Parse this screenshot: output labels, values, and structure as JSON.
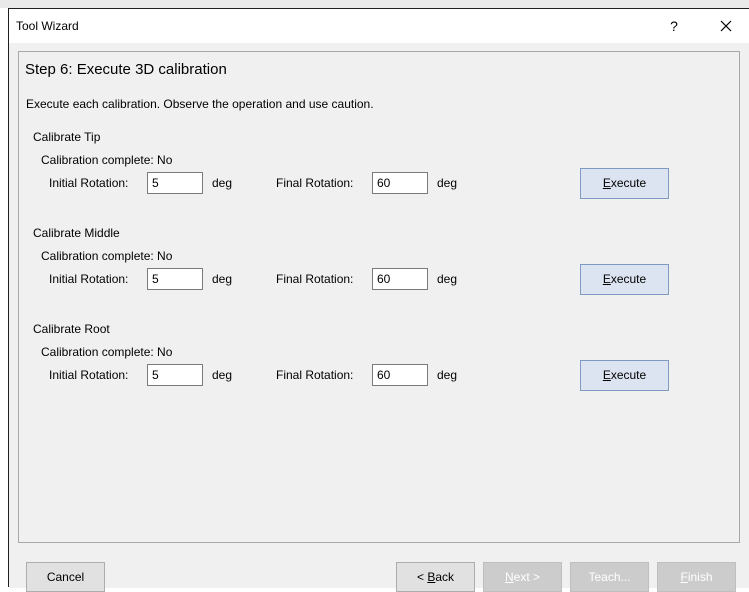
{
  "window": {
    "title": "Tool Wizard",
    "help_label": "?"
  },
  "step": {
    "title": "Step 6: Execute 3D calibration",
    "instructions": "Execute each calibration.  Observe the operation and use caution."
  },
  "calibrations": [
    {
      "title": "Calibrate Tip",
      "status": "Calibration complete: No",
      "initial_label": "Initial Rotation:",
      "initial_value": "5",
      "initial_unit": "deg",
      "final_label": "Final Rotation:",
      "final_value": "60",
      "final_unit": "deg",
      "execute_pre": "",
      "execute_key": "E",
      "execute_post": "xecute"
    },
    {
      "title": "Calibrate Middle",
      "status": "Calibration complete: No",
      "initial_label": "Initial Rotation:",
      "initial_value": "5",
      "initial_unit": "deg",
      "final_label": "Final Rotation:",
      "final_value": "60",
      "final_unit": "deg",
      "execute_pre": "",
      "execute_key": "E",
      "execute_post": "xecute"
    },
    {
      "title": "Calibrate Root",
      "status": "Calibration complete: No",
      "initial_label": "Initial Rotation:",
      "initial_value": "5",
      "initial_unit": "deg",
      "final_label": "Final Rotation:",
      "final_value": "60",
      "final_unit": "deg",
      "execute_pre": "",
      "execute_key": "E",
      "execute_post": "xecute"
    }
  ],
  "footer": {
    "cancel": "Cancel",
    "back_pre": "< ",
    "back_key": "B",
    "back_post": "ack",
    "next_key": "N",
    "next_post": "ext >",
    "teach": "Teach...",
    "finish_key": "F",
    "finish_post": "inish"
  }
}
